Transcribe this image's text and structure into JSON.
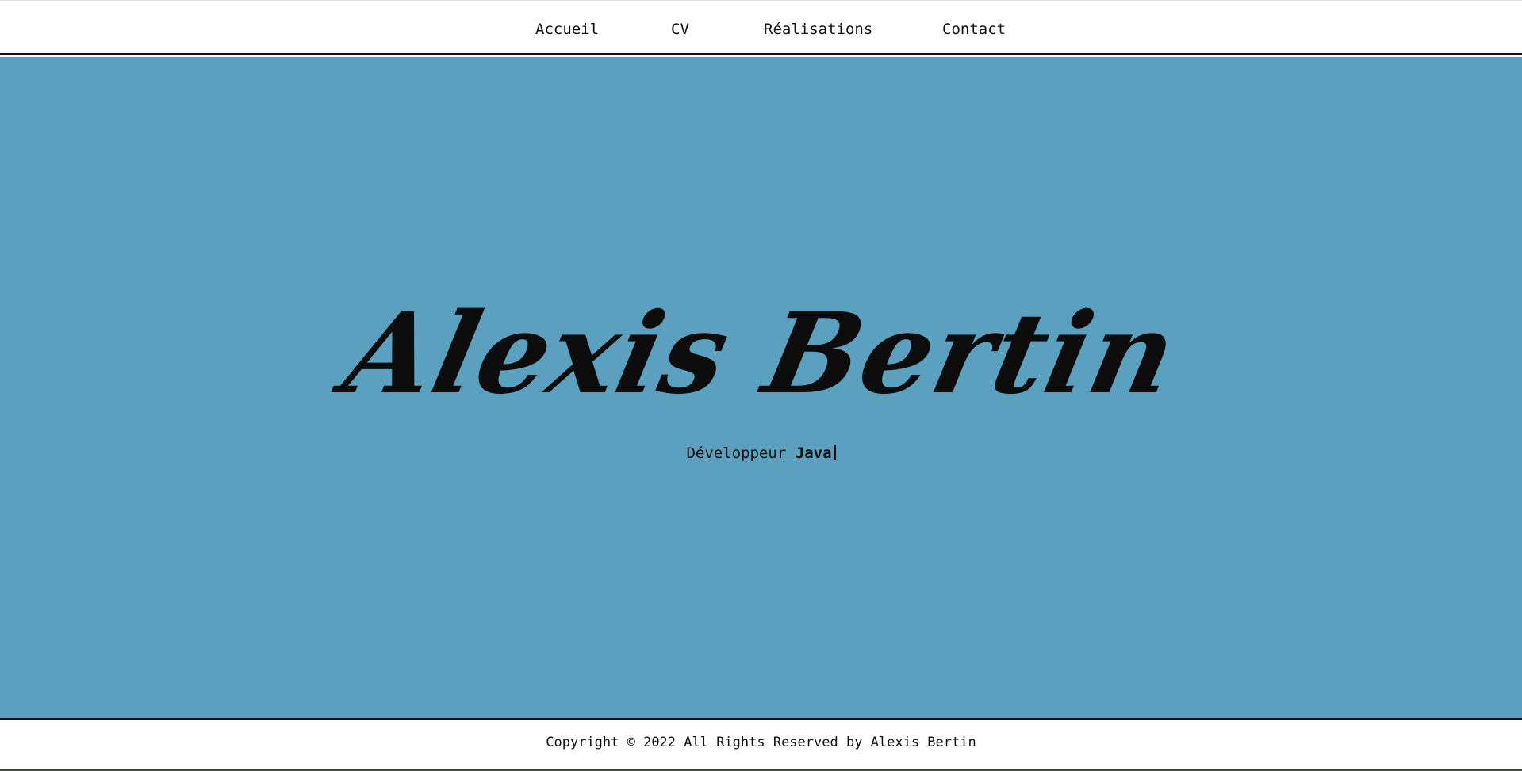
{
  "nav": {
    "items": [
      {
        "label": "Accueil"
      },
      {
        "label": "CV"
      },
      {
        "label": "Réalisations"
      },
      {
        "label": "Contact"
      }
    ]
  },
  "hero": {
    "name": "Alexis Bertin",
    "subtitle_prefix": "Développeur",
    "subtitle_typed": "Java",
    "background_color": "#5ba1bf"
  },
  "footer": {
    "copyright": "Copyright © 2022 All Rights Reserved by Alexis Bertin"
  }
}
